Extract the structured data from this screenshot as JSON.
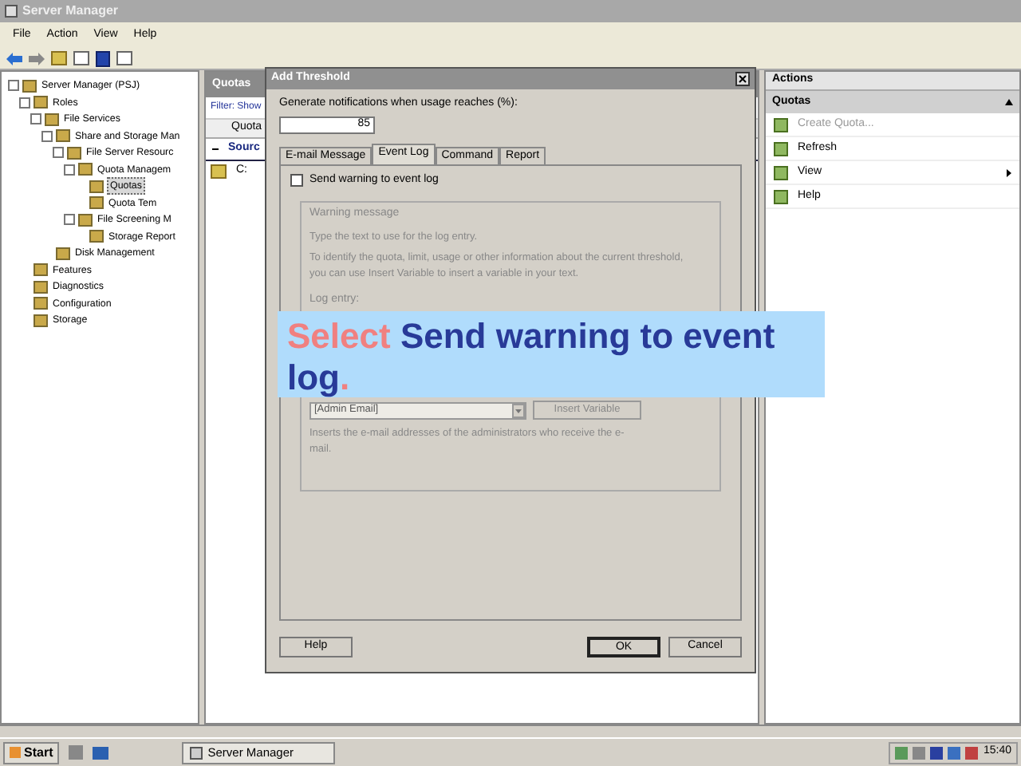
{
  "window": {
    "title": "Server Manager"
  },
  "menu": [
    "File",
    "Action",
    "View",
    "Help"
  ],
  "tree": [
    {
      "label": "Server Manager (PSJ)",
      "selected": false,
      "children": [
        {
          "label": "Roles",
          "selected": false,
          "children": [
            {
              "label": "File Services",
              "selected": false,
              "children": [
                {
                  "label": "Share and Storage Man",
                  "selected": false,
                  "children": [
                    {
                      "label": "File Server Resourc",
                      "selected": false,
                      "children": [
                        {
                          "label": "Quota Managem",
                          "selected": false,
                          "children": [
                            {
                              "label": "Quotas",
                              "selected": true
                            },
                            {
                              "label": "Quota Tem",
                              "selected": false
                            }
                          ]
                        },
                        {
                          "label": "File Screening M",
                          "selected": false,
                          "children": [
                            {
                              "label": "Storage Report",
                              "selected": false
                            }
                          ]
                        }
                      ]
                    }
                  ]
                },
                {
                  "label": "Disk Management",
                  "selected": false
                }
              ]
            }
          ]
        },
        {
          "label": "Features",
          "selected": false
        },
        {
          "label": "Diagnostics",
          "selected": false
        },
        {
          "label": "Configuration",
          "selected": false
        },
        {
          "label": "Storage",
          "selected": false
        }
      ]
    }
  ],
  "middle": {
    "title": "Quotas",
    "filter": "Filter: Show",
    "column": "Quota",
    "group": "Sourc",
    "rows": [
      "C:"
    ]
  },
  "dialog": {
    "title": "Add Threshold",
    "prompt": "Generate notifications when usage reaches (%):",
    "value": "85",
    "tabs": [
      {
        "label": "E-mail Message",
        "selected": false
      },
      {
        "label": "Event Log",
        "selected": true
      },
      {
        "label": "Command",
        "selected": false
      },
      {
        "label": "Report",
        "selected": false
      }
    ],
    "checkbox": {
      "label": "Send warning to event log",
      "checked": false
    },
    "group_title": "Warning message",
    "hint": "Type the text to use for the log entry.",
    "info": "To identify the quota, limit, usage or other information about the current threshold, you can use Insert Variable to insert a variable in your text.",
    "log_label": "Log entry:",
    "variable": "[Admin Email]",
    "insert_button": "Insert Variable",
    "variable_help": "Inserts the e-mail addresses of the administrators who receive the e-mail.",
    "buttons": {
      "help": "Help",
      "ok": "OK",
      "cancel": "Cancel"
    }
  },
  "callout": {
    "action": "Select",
    "target": "Send warning to event log",
    "end": "."
  },
  "actions": {
    "title": "Actions",
    "section": "Quotas",
    "items": [
      {
        "label": "Create Quota...",
        "disabled": true,
        "submenu": false
      },
      {
        "label": "Refresh",
        "disabled": false,
        "submenu": false
      },
      {
        "label": "View",
        "disabled": false,
        "submenu": true
      },
      {
        "label": "Help",
        "disabled": false,
        "submenu": false
      }
    ]
  },
  "taskbar": {
    "start": "Start",
    "task": "Server Manager",
    "time": "15:40"
  }
}
